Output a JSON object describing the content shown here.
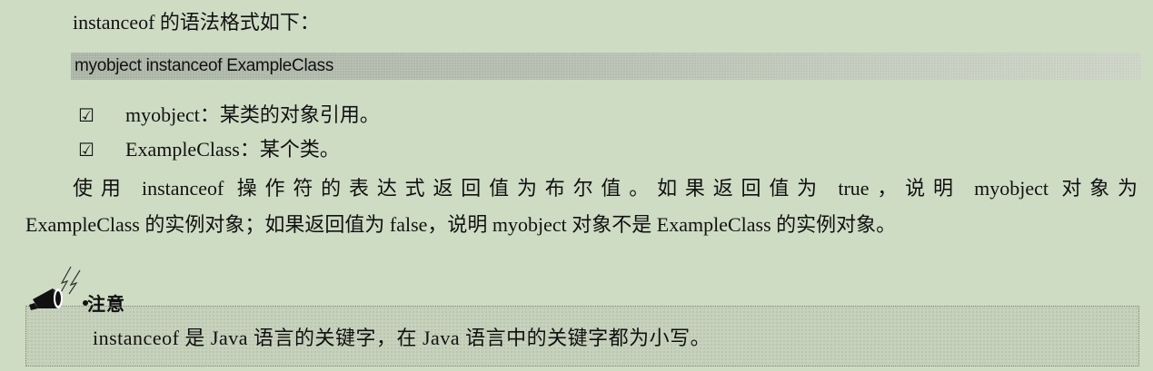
{
  "intro": "instanceof 的语法格式如下：",
  "code": "myobject instanceof ExampleClass",
  "bullets": [
    {
      "mark": "☑",
      "text": "myobject：某类的对象引用。"
    },
    {
      "mark": "☑",
      "text": "ExampleClass：某个类。"
    }
  ],
  "paragraph_line1": "使用 instanceof 操作符的表达式返回值为布尔值。如果返回值为 true，说明 myobject 对象为",
  "paragraph_line2": "ExampleClass 的实例对象；如果返回值为 false，说明 myobject 对象不是 ExampleClass 的实例对象。",
  "note": {
    "title": "注意",
    "icon": "megaphone-icon",
    "text": "instanceof 是 Java 语言的关键字，在 Java 语言中的关键字都为小写。"
  }
}
